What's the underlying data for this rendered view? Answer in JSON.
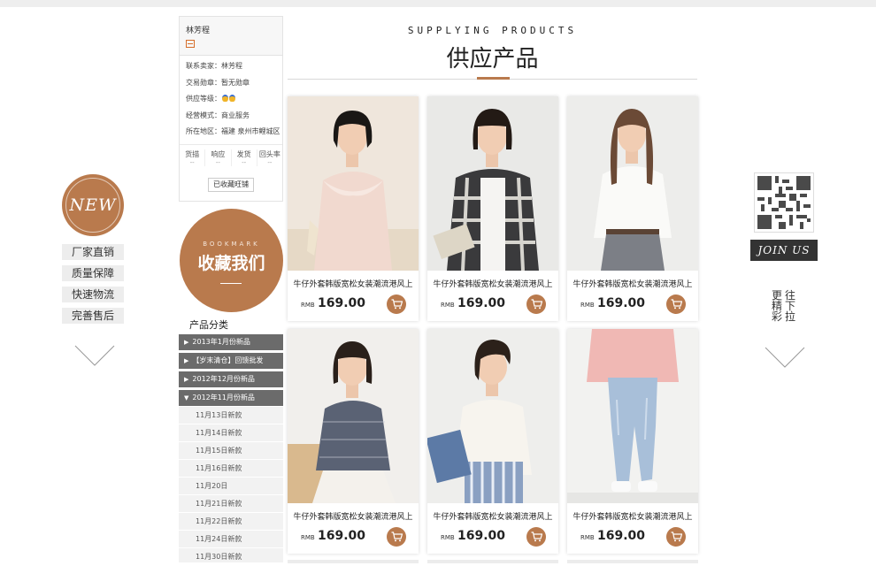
{
  "left_promo": {
    "new_badge": "NEW",
    "features": [
      "厂家直销",
      "质量保障",
      "快速物流",
      "完善售后"
    ]
  },
  "seller": {
    "name": "林芳程",
    "contact": "联系卖家：林芳程",
    "medal": "交易勋章：暂无勋章",
    "level": "供应等级：",
    "mode": "经营模式：商业服务",
    "location": "所在地区：福建 泉州市鲤城区",
    "stats": [
      {
        "label": "货描",
        "value": "--"
      },
      {
        "label": "响应",
        "value": "--"
      },
      {
        "label": "发货",
        "value": "--"
      },
      {
        "label": "回头率",
        "value": "--"
      }
    ],
    "fav_button": "已收藏旺铺"
  },
  "bookmark": {
    "en": "BOOKMARK",
    "cn": "收藏我们"
  },
  "categories": {
    "title": "产品分类",
    "groups": [
      "2013年1月份新品",
      "【岁末清仓】回馈批发",
      "2012年12月份新品",
      "2012年11月份新品"
    ],
    "subs": [
      "11月13日新款",
      "11月14日新款",
      "11月15日新款",
      "11月16日新款",
      "11月20日",
      "11月21日新款",
      "11月22日新款",
      "11月24日新款",
      "11月30日新款"
    ]
  },
  "heading": {
    "en": "SUPPLYING PRODUCTS",
    "cn": "供应产品"
  },
  "products": [
    {
      "name": "牛仔外套韩版宽松女装潮流港风上",
      "currency": "RMB",
      "price": "169.00"
    },
    {
      "name": "牛仔外套韩版宽松女装潮流港风上",
      "currency": "RMB",
      "price": "169.00"
    },
    {
      "name": "牛仔外套韩版宽松女装潮流港风上",
      "currency": "RMB",
      "price": "169.00"
    },
    {
      "name": "牛仔外套韩版宽松女装潮流港风上",
      "currency": "RMB",
      "price": "169.00"
    },
    {
      "name": "牛仔外套韩版宽松女装潮流港风上",
      "currency": "RMB",
      "price": "169.00"
    },
    {
      "name": "牛仔外套韩版宽松女装潮流港风上",
      "currency": "RMB",
      "price": "169.00"
    }
  ],
  "right": {
    "join": "JOIN US",
    "col1": "往下拉",
    "col2": "更精彩"
  },
  "colors": {
    "accent": "#b97a4d",
    "dark": "#333333"
  }
}
